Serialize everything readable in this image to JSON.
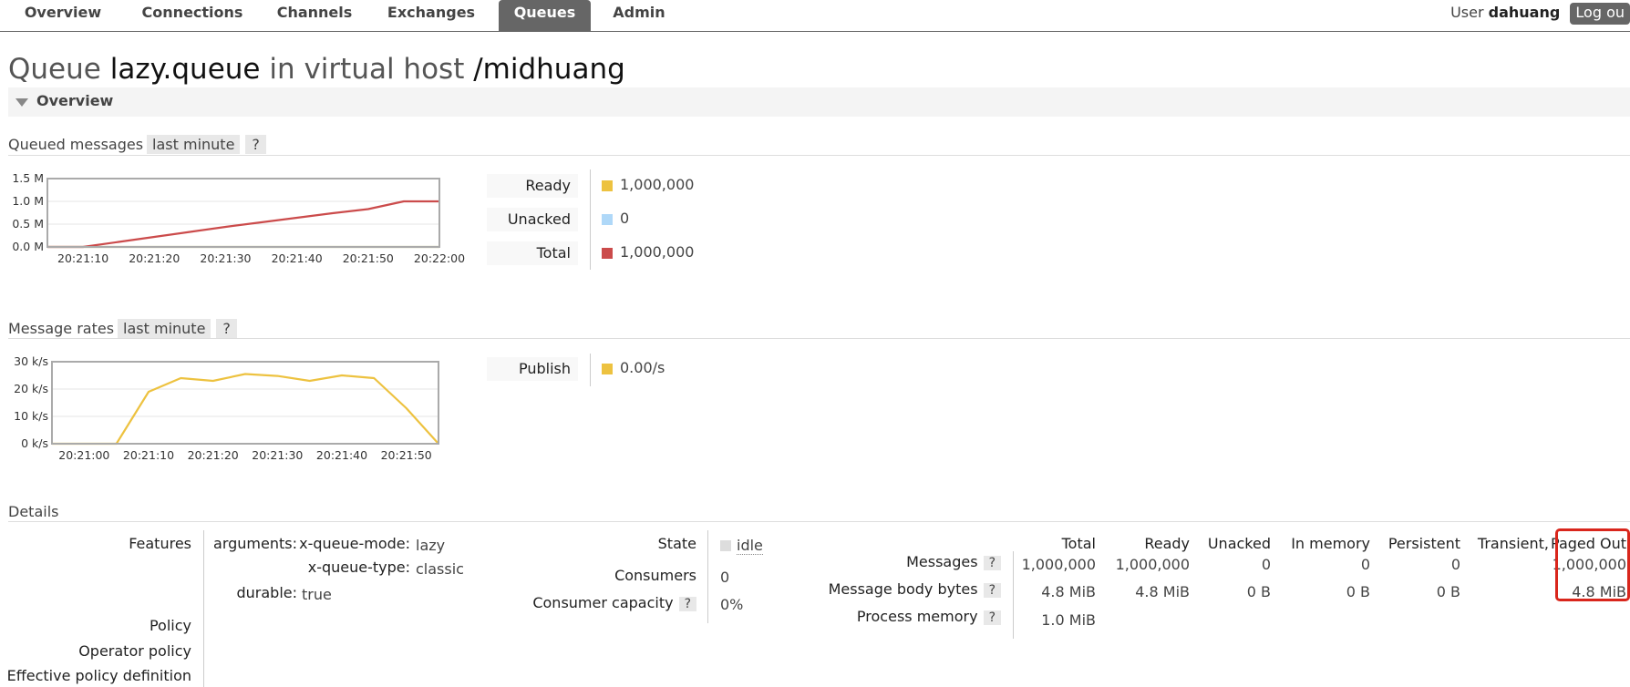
{
  "nav": {
    "tabs": [
      {
        "label": "Overview"
      },
      {
        "label": "Connections"
      },
      {
        "label": "Channels"
      },
      {
        "label": "Exchanges"
      },
      {
        "label": "Queues",
        "active": true
      },
      {
        "label": "Admin"
      }
    ],
    "user_label": "User",
    "user_name": "dahuang",
    "logout_label": "Log ou"
  },
  "title": {
    "prefix": "Queue",
    "queue_name": "lazy.queue",
    "middle": "in virtual host",
    "vhost": "/midhuang"
  },
  "overview": {
    "label": "Overview"
  },
  "queued_messages": {
    "heading": "Queued messages",
    "range": "last minute",
    "help": "?",
    "legend": [
      {
        "label": "Ready",
        "value": "1,000,000",
        "color": "#edc240"
      },
      {
        "label": "Unacked",
        "value": "0",
        "color": "#afd8f8"
      },
      {
        "label": "Total",
        "value": "1,000,000",
        "color": "#cb4b4b"
      }
    ]
  },
  "message_rates": {
    "heading": "Message rates",
    "range": "last minute",
    "help": "?",
    "legend": [
      {
        "label": "Publish",
        "value": "0.00/s",
        "color": "#edc240"
      }
    ]
  },
  "chart_data": [
    {
      "type": "line",
      "x": [
        "20:21:05",
        "20:21:10",
        "20:21:15",
        "20:21:20",
        "20:21:25",
        "20:21:30",
        "20:21:35",
        "20:21:40",
        "20:21:45",
        "20:21:50",
        "20:21:55",
        "20:22:00"
      ],
      "x_ticks": [
        "20:21:10",
        "20:21:20",
        "20:21:30",
        "20:21:40",
        "20:21:50",
        "20:22:00"
      ],
      "y_ticks": [
        "0.0 M",
        "0.5 M",
        "1.0 M",
        "1.5 M"
      ],
      "ylim": [
        0,
        1500000
      ],
      "series": [
        {
          "color": "#edc240",
          "values": [
            0,
            0,
            0,
            0,
            0,
            0,
            0,
            0,
            0,
            0,
            0,
            0
          ]
        },
        {
          "color": "#afd8f8",
          "values": [
            0,
            0,
            0,
            0,
            0,
            0,
            0,
            0,
            0,
            0,
            0,
            0
          ]
        },
        {
          "color": "#cb4b4b",
          "values": [
            0,
            0,
            110000,
            220000,
            330000,
            440000,
            540000,
            640000,
            740000,
            830000,
            1000000,
            1000000
          ]
        }
      ]
    },
    {
      "type": "line",
      "x": [
        "20:20:55",
        "20:21:00",
        "20:21:05",
        "20:21:10",
        "20:21:15",
        "20:21:20",
        "20:21:25",
        "20:21:30",
        "20:21:35",
        "20:21:40",
        "20:21:45",
        "20:21:50",
        "20:21:55"
      ],
      "x_ticks": [
        "20:21:00",
        "20:21:10",
        "20:21:20",
        "20:21:30",
        "20:21:40",
        "20:21:50"
      ],
      "y_ticks": [
        "0 k/s",
        "10 k/s",
        "20 k/s",
        "30 k/s"
      ],
      "ylim": [
        0,
        30000
      ],
      "series": [
        {
          "color": "#edc240",
          "values": [
            0,
            0,
            0,
            19000,
            24000,
            23000,
            25500,
            24800,
            23000,
            25000,
            24000,
            13000,
            0
          ]
        }
      ]
    }
  ],
  "details": {
    "heading": "Details",
    "features_label": "Features",
    "arguments_label": "arguments:",
    "args": [
      {
        "key": "x-queue-mode:",
        "value": "lazy"
      },
      {
        "key": "x-queue-type:",
        "value": "classic"
      }
    ],
    "durable_label": "durable:",
    "durable_value": "true",
    "policy_label": "Policy",
    "operator_policy_label": "Operator policy",
    "effective_policy_label": "Effective policy definition",
    "state_label": "State",
    "state_value": "idle",
    "consumers_label": "Consumers",
    "consumers_value": "0",
    "consumer_capacity_label": "Consumer capacity",
    "consumer_capacity_value": "0%",
    "help": "?",
    "columns": [
      "Total",
      "Ready",
      "Unacked",
      "In memory",
      "Persistent",
      "Transient,",
      "Paged Out"
    ],
    "rows": [
      {
        "label": "Messages",
        "cells": [
          "1,000,000",
          "1,000,000",
          "0",
          "0",
          "0",
          "",
          "1,000,000"
        ]
      },
      {
        "label": "Message body bytes",
        "cells": [
          "4.8 MiB",
          "4.8 MiB",
          "0 B",
          "0 B",
          "0 B",
          "",
          "4.8 MiB"
        ]
      },
      {
        "label": "Process memory",
        "cells": [
          "1.0 MiB",
          "",
          "",
          "",
          "",
          "",
          ""
        ]
      }
    ]
  }
}
